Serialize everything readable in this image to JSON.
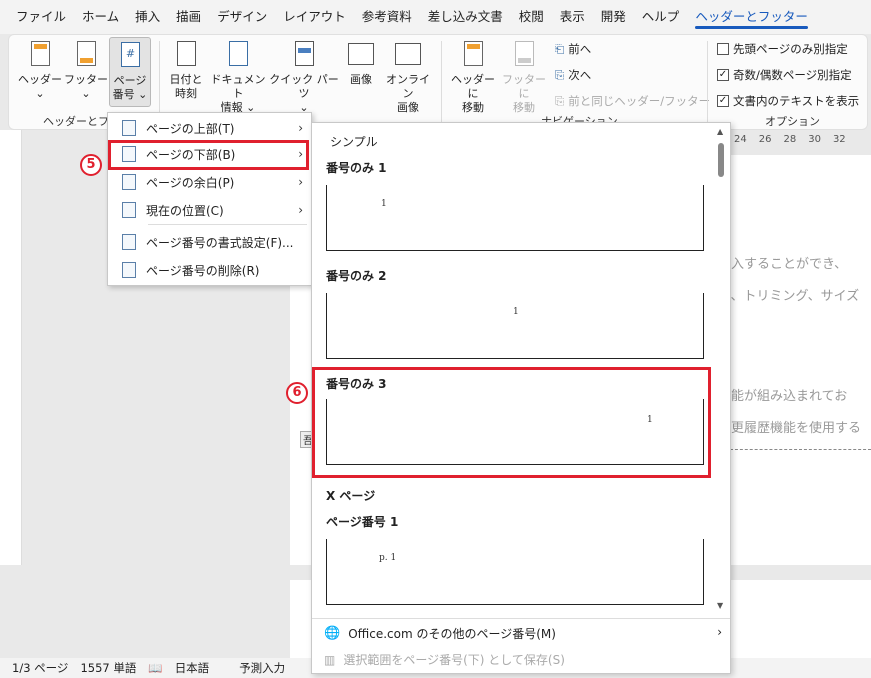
{
  "menu_tabs": [
    "ファイル",
    "ホーム",
    "挿入",
    "描画",
    "デザイン",
    "レイアウト",
    "参考資料",
    "差し込み文書",
    "校閲",
    "表示",
    "開発",
    "ヘルプ",
    "ヘッダーとフッター"
  ],
  "ribbon": {
    "header_label": "ヘッダー",
    "footer_label": "フッター",
    "page_number_label_1": "ページ",
    "page_number_label_2": "番号",
    "date_label_1": "日付と",
    "date_label_2": "時刻",
    "docinfo_label_1": "ドキュメント",
    "docinfo_label_2": "情報",
    "quickparts_label": "クイック パーツ",
    "image_label": "画像",
    "online_image_label_1": "オンライン",
    "online_image_label_2": "画像",
    "goto_header_label_1": "ヘッダーに",
    "goto_header_label_2": "移動",
    "goto_footer_label_1": "フッターに",
    "goto_footer_label_2": "移動",
    "prev_label": "前へ",
    "next_label": "次へ",
    "link_prev_label": "前と同じヘッダー/フッター",
    "group_hf": "ヘッダーとフッ",
    "group_nav": "ナビゲーション",
    "group_options": "オプション",
    "opt_first_page": "先頭ページのみ別指定",
    "opt_odd_even": "奇数/偶数ページ別指定",
    "opt_show_text": "文書内のテキストを表示",
    "opt_checks": [
      "",
      "✓",
      "✓"
    ]
  },
  "ruler_numbers": [
    "24",
    "26",
    "28",
    "30",
    "32"
  ],
  "doc_lines": [
    "挿入することができ、",
    "り、トリミング、サイズ",
    "機能が組み込まれてお",
    "変更履歴機能を使用する"
  ],
  "doc_stub": "吾",
  "page_number_menu": [
    {
      "label": "ページの上部(T)",
      "has_arrow": true
    },
    {
      "label": "ページの下部(B)",
      "has_arrow": true
    },
    {
      "label": "ページの余白(P)",
      "has_arrow": true
    },
    {
      "label": "現在の位置(C)",
      "has_arrow": true
    },
    {
      "label": "ページ番号の書式設定(F)...",
      "has_arrow": false
    },
    {
      "label": "ページ番号の削除(R)",
      "has_arrow": false
    }
  ],
  "gallery": {
    "section_simple": "シンプル",
    "items": [
      {
        "title": "番号のみ 1",
        "sample": "1"
      },
      {
        "title": "番号のみ 2",
        "sample": "1"
      },
      {
        "title": "番号のみ 3",
        "sample": "1"
      }
    ],
    "section_x_page": "X ページ",
    "x_items": [
      {
        "title": "ページ番号 1",
        "sample": "p. 1"
      }
    ],
    "more_label": "Office.com のその他のページ番号(M)",
    "save_label": "選択範囲をページ番号(下) として保存(S)"
  },
  "annotations": {
    "step5": "5",
    "step6": "6"
  },
  "status": {
    "page": "1/3 ページ",
    "words": "1557 単語",
    "lang": "日本語",
    "predict": "予測入力"
  },
  "colors": {
    "accent": "#185abd",
    "highlight_red": "#e0202e"
  }
}
